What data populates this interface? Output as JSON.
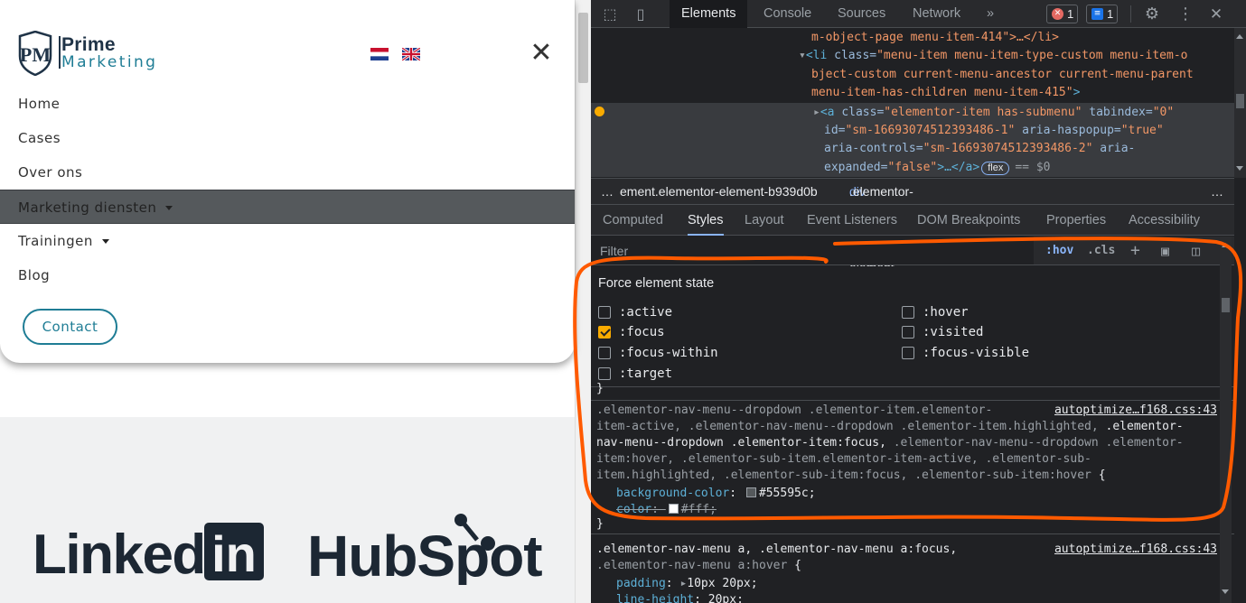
{
  "site": {
    "logo": {
      "word1": "Prime",
      "word2": "Marketing",
      "mono": "PM"
    },
    "close_label": "✕",
    "nav": [
      {
        "label": "Home",
        "has_caret": false,
        "active": false
      },
      {
        "label": "Cases",
        "has_caret": false,
        "active": false
      },
      {
        "label": "Over ons",
        "has_caret": false,
        "active": false
      },
      {
        "label": "Marketing diensten",
        "has_caret": true,
        "active": true
      },
      {
        "label": "Trainingen",
        "has_caret": true,
        "active": false
      },
      {
        "label": "Blog",
        "has_caret": false,
        "active": false
      }
    ],
    "contact_label": "Contact",
    "partner_logos": {
      "linkedin_word": "Linked",
      "linkedin_box": "in",
      "hubspot": "HubSpot"
    },
    "colors": {
      "brand_teal": "#1f7d95",
      "brand_navy": "#1f3347",
      "active_bg": "#55595c"
    }
  },
  "devtools": {
    "tabs": [
      "Elements",
      "Console",
      "Sources",
      "Network",
      "»"
    ],
    "selected_tab": "Elements",
    "error_count": "1",
    "message_count": "1",
    "dom": {
      "line1": "m-object-page menu-item-414\">…</li>",
      "line2_tag": "<li ",
      "line2_attr": "class=",
      "line2_val_a": "\"menu-item menu-item-type-custom menu-item-o",
      "line3_val": "bject-custom current-menu-ancestor current-menu-parent",
      "line4_val": "menu-item-has-children menu-item-415\"",
      "line4_end": ">",
      "line5_tag": "<a ",
      "line5_attr": "class=",
      "line5_val": "\"elementor-item has-submenu\"",
      "line5_attr2": " tabindex=",
      "line5_val2": "\"0\"",
      "line6_attr": "id=",
      "line6_val": "\"sm-16693074512393486-1\"",
      "line6_attr2": " aria-haspopup=",
      "line6_val2": "\"true\"",
      "line7_attr": "aria-controls=",
      "line7_val": "\"sm-16693074512393486-2\"",
      "line7_attr2": " aria-",
      "line8_attr": "expanded=",
      "line8_val": "\"false\"",
      "line8_end": ">…</a>",
      "flex_badge": "flex",
      "eq": "== $0"
    },
    "breadcrumb": {
      "ellipsis": "…",
      "c1": "ement.elementor-element-b939d0b",
      "c2_tag": "div",
      "c2_cls": ".elementor-widget-wrap.elementor-element-populated",
      "more": "…"
    },
    "subtabs": [
      "Computed",
      "Styles",
      "Layout",
      "Event Listeners",
      "DOM Breakpoints",
      "Properties",
      "Accessibility"
    ],
    "selected_subtab": "Styles",
    "filter": {
      "placeholder": "Filter",
      "hov": ":hov",
      "cls": ".cls",
      "plus": "+"
    },
    "force_state": {
      "title": "Force element state",
      "states": [
        {
          "label": ":active",
          "checked": false
        },
        {
          "label": ":hover",
          "checked": false
        },
        {
          "label": ":focus",
          "checked": true
        },
        {
          "label": ":visited",
          "checked": false
        },
        {
          "label": ":focus-within",
          "checked": false
        },
        {
          "label": ":focus-visible",
          "checked": false
        },
        {
          "label": ":target",
          "checked": false
        }
      ]
    },
    "rules": [
      {
        "source": "autoptimize…f168.css:43",
        "sel_lines": [
          [
            {
              "t": ".elementor-nav-menu--dropdown .elementor-item.elementor-",
              "m": false
            }
          ],
          [
            {
              "t": "item-active, .elementor-nav-menu--dropdown .elementor-item.highlighted, ",
              "m": false
            },
            {
              "t": ".elementor-",
              "m": true
            }
          ],
          [
            {
              "t": "nav-menu--dropdown .elementor-item:focus,",
              "m": true
            },
            {
              "t": " .elementor-nav-menu--dropdown .elementor-",
              "m": false
            }
          ],
          [
            {
              "t": "item:hover, .elementor-sub-item.elementor-item-active, .elementor-sub-",
              "m": false
            }
          ],
          [
            {
              "t": "item.highlighted, .elementor-sub-item:focus, .elementor-sub-item:hover ",
              "m": false
            },
            {
              "t": "{",
              "m": true
            }
          ]
        ],
        "props": [
          {
            "name": "background-color",
            "value": "#55595c",
            "swatch": "#55595c",
            "struck": false
          },
          {
            "name": "color",
            "value": "#fff",
            "swatch": "#ffffff",
            "struck": true
          }
        ],
        "close": "}"
      },
      {
        "source": "autoptimize…f168.css:43",
        "sel_line1": ".elementor-nav-menu a, .elementor-nav-menu a:focus,",
        "sel_line2": ".elementor-nav-menu a:hover ",
        "open": "{",
        "props": [
          {
            "name": "padding",
            "value": "10px 20px"
          },
          {
            "name": "line-height",
            "value": "20px"
          }
        ]
      }
    ],
    "prev_rule_close": "}",
    "annotation_color": "#ff5a00"
  }
}
